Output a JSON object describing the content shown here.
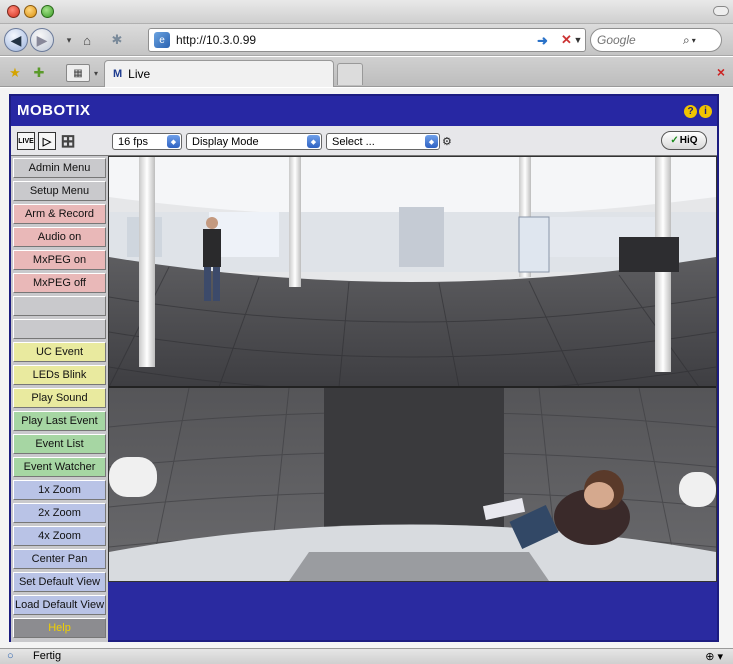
{
  "browser": {
    "url": "http://10.3.0.99",
    "search_placeholder": "Google",
    "tab_label": "Live",
    "status_text": "Fertig"
  },
  "app": {
    "brand": "MOBOTIX",
    "help_icon": "?",
    "info_icon": "i"
  },
  "toolbar": {
    "live_label": "LIVE",
    "fps": "16 fps",
    "display_mode": "Display Mode",
    "select": "Select ...",
    "hiq_label": "HiQ",
    "hiq_check": "✓"
  },
  "sidebar": {
    "buttons": [
      {
        "label": "Admin Menu",
        "color": "#c9c9cc"
      },
      {
        "label": "Setup Menu",
        "color": "#c9c9cc"
      },
      {
        "label": "Arm & Record",
        "color": "#e9b8b8"
      },
      {
        "label": "Audio on",
        "color": "#e9b8b8"
      },
      {
        "label": "MxPEG on",
        "color": "#e9b8b8"
      },
      {
        "label": "MxPEG off",
        "color": "#e9b8b8"
      },
      {
        "label": "",
        "color": "#c9c9cc"
      },
      {
        "label": "",
        "color": "#c9c9cc"
      },
      {
        "label": "UC Event",
        "color": "#e9ea9f"
      },
      {
        "label": "LEDs Blink",
        "color": "#e9ea9f"
      },
      {
        "label": "Play Sound",
        "color": "#e9ea9f"
      },
      {
        "label": "Play Last Event",
        "color": "#a6d6a3"
      },
      {
        "label": "Event List",
        "color": "#a6d6a3"
      },
      {
        "label": "Event Watcher",
        "color": "#a6d6a3"
      },
      {
        "label": "1x Zoom",
        "color": "#b9c3e6"
      },
      {
        "label": "2x Zoom",
        "color": "#b9c3e6"
      },
      {
        "label": "4x Zoom",
        "color": "#b9c3e6"
      },
      {
        "label": "Center Pan",
        "color": "#b9c3e6"
      },
      {
        "label": "Set Default View",
        "color": "#b9c3e6"
      },
      {
        "label": "Load Default View",
        "color": "#b9c3e6"
      },
      {
        "label": "Help",
        "color": "#8c8c90"
      }
    ]
  },
  "colors": {
    "frame": "#2727a3",
    "help_text": "#f0d000"
  }
}
